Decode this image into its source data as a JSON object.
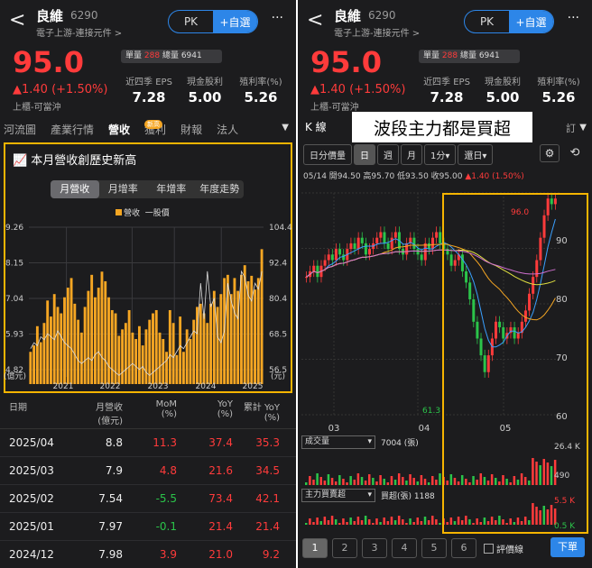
{
  "stock": {
    "name": "良維",
    "code": "6290",
    "industry": "電子上游-連接元件 >",
    "price": "95.0",
    "change": "▲1.40 (+1.50%)",
    "market": "上櫃-可當沖",
    "pk": "PK",
    "watch": "+自選",
    "more": "···",
    "back": "<",
    "vol_label": "單量",
    "vol_val": "288",
    "total_label": "總量 6941",
    "metrics": [
      {
        "label": "近四季 EPS",
        "value": "7.28"
      },
      {
        "label": "現金股利",
        "value": "5.00"
      },
      {
        "label": "殖利率(%)",
        "value": "5.26"
      }
    ]
  },
  "left": {
    "tabs": [
      "河流圖",
      "產業行情",
      "營收",
      "獲利",
      "財報",
      "法人"
    ],
    "new_badge": "新高",
    "tab_arrow": "▼",
    "revenue_title": "本月營收創歷史新高",
    "subtabs": [
      "月營收",
      "月增率",
      "年增率",
      "年度走勢"
    ],
    "legend_rev": "營收",
    "legend_price": "一股價",
    "y_left": [
      "9.26",
      "8.15",
      "7.04",
      "5.93",
      "4.82",
      "(億元)"
    ],
    "y_right": [
      "104.4",
      "92.4",
      "80.4",
      "68.5",
      "56.5",
      "(元)"
    ],
    "x_years": [
      "2021",
      "2022",
      "2023",
      "2024",
      "2025"
    ],
    "table_head": [
      "日期",
      "月營收\n(億元)",
      "MoM\n(%)",
      "YoY\n(%)",
      "累計 YoY\n(%)"
    ],
    "rows": [
      {
        "date": "2025/04",
        "rev": "8.8",
        "mom": "11.3",
        "yoy": "37.4",
        "cum": "35.3"
      },
      {
        "date": "2025/03",
        "rev": "7.9",
        "mom": "4.8",
        "yoy": "21.6",
        "cum": "34.5"
      },
      {
        "date": "2025/02",
        "rev": "7.54",
        "mom": "-5.5",
        "yoy": "73.4",
        "cum": "42.1"
      },
      {
        "date": "2025/01",
        "rev": "7.97",
        "mom": "-0.1",
        "yoy": "21.4",
        "cum": "21.4"
      },
      {
        "date": "2024/12",
        "rev": "7.98",
        "mom": "3.9",
        "yoy": "21.0",
        "cum": "9.2"
      }
    ]
  },
  "right": {
    "ktab": "K 線",
    "annotation": "波段主力都是買超",
    "trailing_tab": "訂",
    "tab_arrow": "▼",
    "period_tabs": [
      "日分價量",
      "日",
      "週",
      "月",
      "1分▾",
      "還日▾"
    ],
    "gear": "⚙",
    "rotate": "⟲",
    "ohlc_pre": "05/14  開94.50  高95.70  低93.50  收95.00  ",
    "ohlc_chg": "▲1.40 (1.50%)",
    "y_ticks": [
      "90",
      "80",
      "70",
      "60"
    ],
    "x_months": [
      "03",
      "04",
      "05"
    ],
    "high_label": "96.0",
    "low_label": "61.3",
    "vol_select": "成交量",
    "vol_text": "7004 (張)",
    "vol_ticks": [
      "26.4 K",
      "490"
    ],
    "main_select": "主力買賣超",
    "main_text": "買超(張) 1188",
    "main_ticks": [
      "5.5 K",
      "0.5 K"
    ],
    "pages": [
      "1",
      "2",
      "3",
      "4",
      "5",
      "6"
    ],
    "eval_line": "評價線",
    "order": "下單"
  },
  "chart_data": {
    "type": "bar",
    "title": "本月營收創歷史新高",
    "series": [
      {
        "name": "營收",
        "values": [
          5.6,
          5.8,
          6.4,
          5.9,
          6.5,
          7.2,
          6.7,
          7.4,
          7.0,
          6.8,
          7.3,
          7.6,
          7.9,
          7.1,
          6.6,
          6.2,
          7.0,
          7.5,
          8.0,
          7.3,
          7.6,
          8.1,
          7.8,
          7.3,
          6.9,
          6.8,
          6.1,
          6.3,
          6.5,
          6.9,
          6.2,
          6.0,
          6.4,
          5.8,
          6.3,
          6.6,
          6.8,
          6.9,
          6.2,
          6.0,
          5.6,
          6.9,
          6.5,
          5.5,
          6.7,
          5.6,
          6.3,
          6.0,
          6.6,
          7.0,
          7.1,
          6.8,
          6.5,
          7.1,
          7.5,
          7.0,
          7.4,
          7.9,
          8.0,
          7.4,
          7.9,
          7.5,
          8.0,
          8.3,
          7.8,
          7.97,
          7.54,
          7.9,
          8.8
        ]
      },
      {
        "name": "一股價",
        "values": [
          66,
          68,
          67,
          70,
          69,
          71,
          70,
          69,
          72,
          70,
          68,
          67,
          66,
          64,
          62,
          61,
          62,
          63,
          62,
          64,
          65,
          63,
          62,
          60,
          59,
          58,
          57,
          58,
          59,
          60,
          61,
          60,
          59,
          60,
          58,
          57,
          58,
          59,
          60,
          61,
          62,
          64,
          63,
          65,
          67,
          66,
          68,
          70,
          72,
          71,
          88,
          76,
          92,
          80,
          83,
          70,
          68,
          72,
          88,
          82,
          78,
          76,
          92,
          90,
          84,
          82,
          88,
          86,
          92
        ]
      }
    ],
    "ylim": [
      4.82,
      9.26
    ],
    "ylim_right": [
      56.5,
      104.4
    ]
  }
}
